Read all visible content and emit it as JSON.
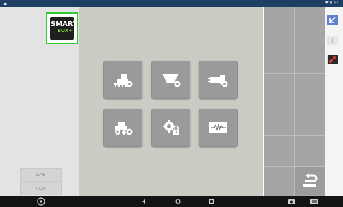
{
  "status_bar": {
    "left_glyph": "▲",
    "right_text": "▼ 9:44"
  },
  "logo": {
    "line1": "SMART",
    "line2": "BOX+"
  },
  "soft_keys": {
    "ack": "ACK",
    "aux": "AUX"
  },
  "tiles": [
    {
      "icon": "implement-settings-icon"
    },
    {
      "icon": "spreader-settings-icon"
    },
    {
      "icon": "sensor-settings-icon"
    },
    {
      "icon": "tractor-settings-icon"
    },
    {
      "icon": "lock-settings-icon"
    },
    {
      "icon": "diagnostics-signal-icon"
    }
  ],
  "colors": {
    "status_bar": "#1d3f63",
    "logo_border": "#32c832",
    "logo_accent": "#8fd13a",
    "tile": "#9a9a9a",
    "main_bg": "#cbcbc4",
    "grid_bg": "#a5a5a5",
    "side_blue": "#5f7fd0"
  }
}
